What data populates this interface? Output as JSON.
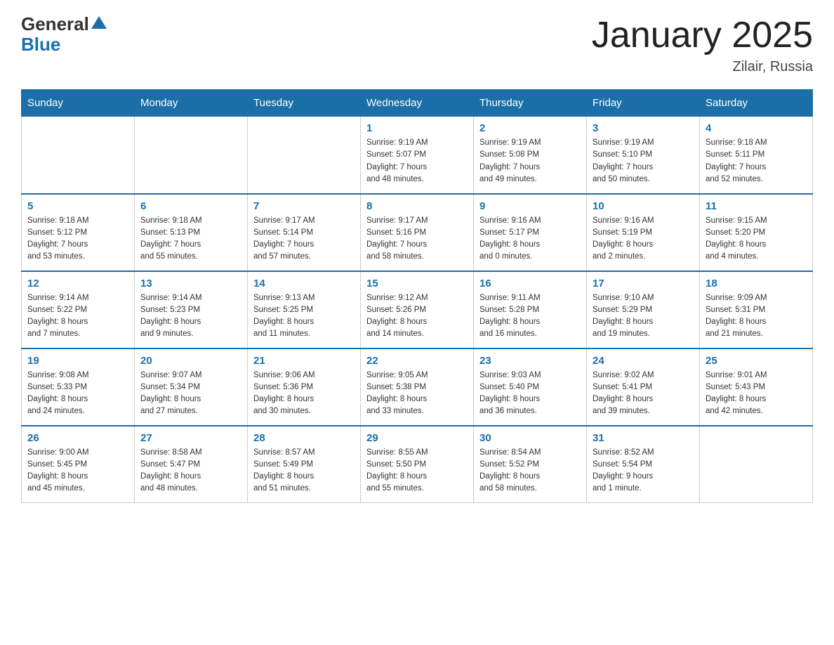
{
  "header": {
    "logo_general": "General",
    "logo_blue": "Blue",
    "month_title": "January 2025",
    "location": "Zilair, Russia"
  },
  "weekdays": [
    "Sunday",
    "Monday",
    "Tuesday",
    "Wednesday",
    "Thursday",
    "Friday",
    "Saturday"
  ],
  "weeks": [
    [
      {
        "day": "",
        "info": ""
      },
      {
        "day": "",
        "info": ""
      },
      {
        "day": "",
        "info": ""
      },
      {
        "day": "1",
        "info": "Sunrise: 9:19 AM\nSunset: 5:07 PM\nDaylight: 7 hours\nand 48 minutes."
      },
      {
        "day": "2",
        "info": "Sunrise: 9:19 AM\nSunset: 5:08 PM\nDaylight: 7 hours\nand 49 minutes."
      },
      {
        "day": "3",
        "info": "Sunrise: 9:19 AM\nSunset: 5:10 PM\nDaylight: 7 hours\nand 50 minutes."
      },
      {
        "day": "4",
        "info": "Sunrise: 9:18 AM\nSunset: 5:11 PM\nDaylight: 7 hours\nand 52 minutes."
      }
    ],
    [
      {
        "day": "5",
        "info": "Sunrise: 9:18 AM\nSunset: 5:12 PM\nDaylight: 7 hours\nand 53 minutes."
      },
      {
        "day": "6",
        "info": "Sunrise: 9:18 AM\nSunset: 5:13 PM\nDaylight: 7 hours\nand 55 minutes."
      },
      {
        "day": "7",
        "info": "Sunrise: 9:17 AM\nSunset: 5:14 PM\nDaylight: 7 hours\nand 57 minutes."
      },
      {
        "day": "8",
        "info": "Sunrise: 9:17 AM\nSunset: 5:16 PM\nDaylight: 7 hours\nand 58 minutes."
      },
      {
        "day": "9",
        "info": "Sunrise: 9:16 AM\nSunset: 5:17 PM\nDaylight: 8 hours\nand 0 minutes."
      },
      {
        "day": "10",
        "info": "Sunrise: 9:16 AM\nSunset: 5:19 PM\nDaylight: 8 hours\nand 2 minutes."
      },
      {
        "day": "11",
        "info": "Sunrise: 9:15 AM\nSunset: 5:20 PM\nDaylight: 8 hours\nand 4 minutes."
      }
    ],
    [
      {
        "day": "12",
        "info": "Sunrise: 9:14 AM\nSunset: 5:22 PM\nDaylight: 8 hours\nand 7 minutes."
      },
      {
        "day": "13",
        "info": "Sunrise: 9:14 AM\nSunset: 5:23 PM\nDaylight: 8 hours\nand 9 minutes."
      },
      {
        "day": "14",
        "info": "Sunrise: 9:13 AM\nSunset: 5:25 PM\nDaylight: 8 hours\nand 11 minutes."
      },
      {
        "day": "15",
        "info": "Sunrise: 9:12 AM\nSunset: 5:26 PM\nDaylight: 8 hours\nand 14 minutes."
      },
      {
        "day": "16",
        "info": "Sunrise: 9:11 AM\nSunset: 5:28 PM\nDaylight: 8 hours\nand 16 minutes."
      },
      {
        "day": "17",
        "info": "Sunrise: 9:10 AM\nSunset: 5:29 PM\nDaylight: 8 hours\nand 19 minutes."
      },
      {
        "day": "18",
        "info": "Sunrise: 9:09 AM\nSunset: 5:31 PM\nDaylight: 8 hours\nand 21 minutes."
      }
    ],
    [
      {
        "day": "19",
        "info": "Sunrise: 9:08 AM\nSunset: 5:33 PM\nDaylight: 8 hours\nand 24 minutes."
      },
      {
        "day": "20",
        "info": "Sunrise: 9:07 AM\nSunset: 5:34 PM\nDaylight: 8 hours\nand 27 minutes."
      },
      {
        "day": "21",
        "info": "Sunrise: 9:06 AM\nSunset: 5:36 PM\nDaylight: 8 hours\nand 30 minutes."
      },
      {
        "day": "22",
        "info": "Sunrise: 9:05 AM\nSunset: 5:38 PM\nDaylight: 8 hours\nand 33 minutes."
      },
      {
        "day": "23",
        "info": "Sunrise: 9:03 AM\nSunset: 5:40 PM\nDaylight: 8 hours\nand 36 minutes."
      },
      {
        "day": "24",
        "info": "Sunrise: 9:02 AM\nSunset: 5:41 PM\nDaylight: 8 hours\nand 39 minutes."
      },
      {
        "day": "25",
        "info": "Sunrise: 9:01 AM\nSunset: 5:43 PM\nDaylight: 8 hours\nand 42 minutes."
      }
    ],
    [
      {
        "day": "26",
        "info": "Sunrise: 9:00 AM\nSunset: 5:45 PM\nDaylight: 8 hours\nand 45 minutes."
      },
      {
        "day": "27",
        "info": "Sunrise: 8:58 AM\nSunset: 5:47 PM\nDaylight: 8 hours\nand 48 minutes."
      },
      {
        "day": "28",
        "info": "Sunrise: 8:57 AM\nSunset: 5:49 PM\nDaylight: 8 hours\nand 51 minutes."
      },
      {
        "day": "29",
        "info": "Sunrise: 8:55 AM\nSunset: 5:50 PM\nDaylight: 8 hours\nand 55 minutes."
      },
      {
        "day": "30",
        "info": "Sunrise: 8:54 AM\nSunset: 5:52 PM\nDaylight: 8 hours\nand 58 minutes."
      },
      {
        "day": "31",
        "info": "Sunrise: 8:52 AM\nSunset: 5:54 PM\nDaylight: 9 hours\nand 1 minute."
      },
      {
        "day": "",
        "info": ""
      }
    ]
  ]
}
